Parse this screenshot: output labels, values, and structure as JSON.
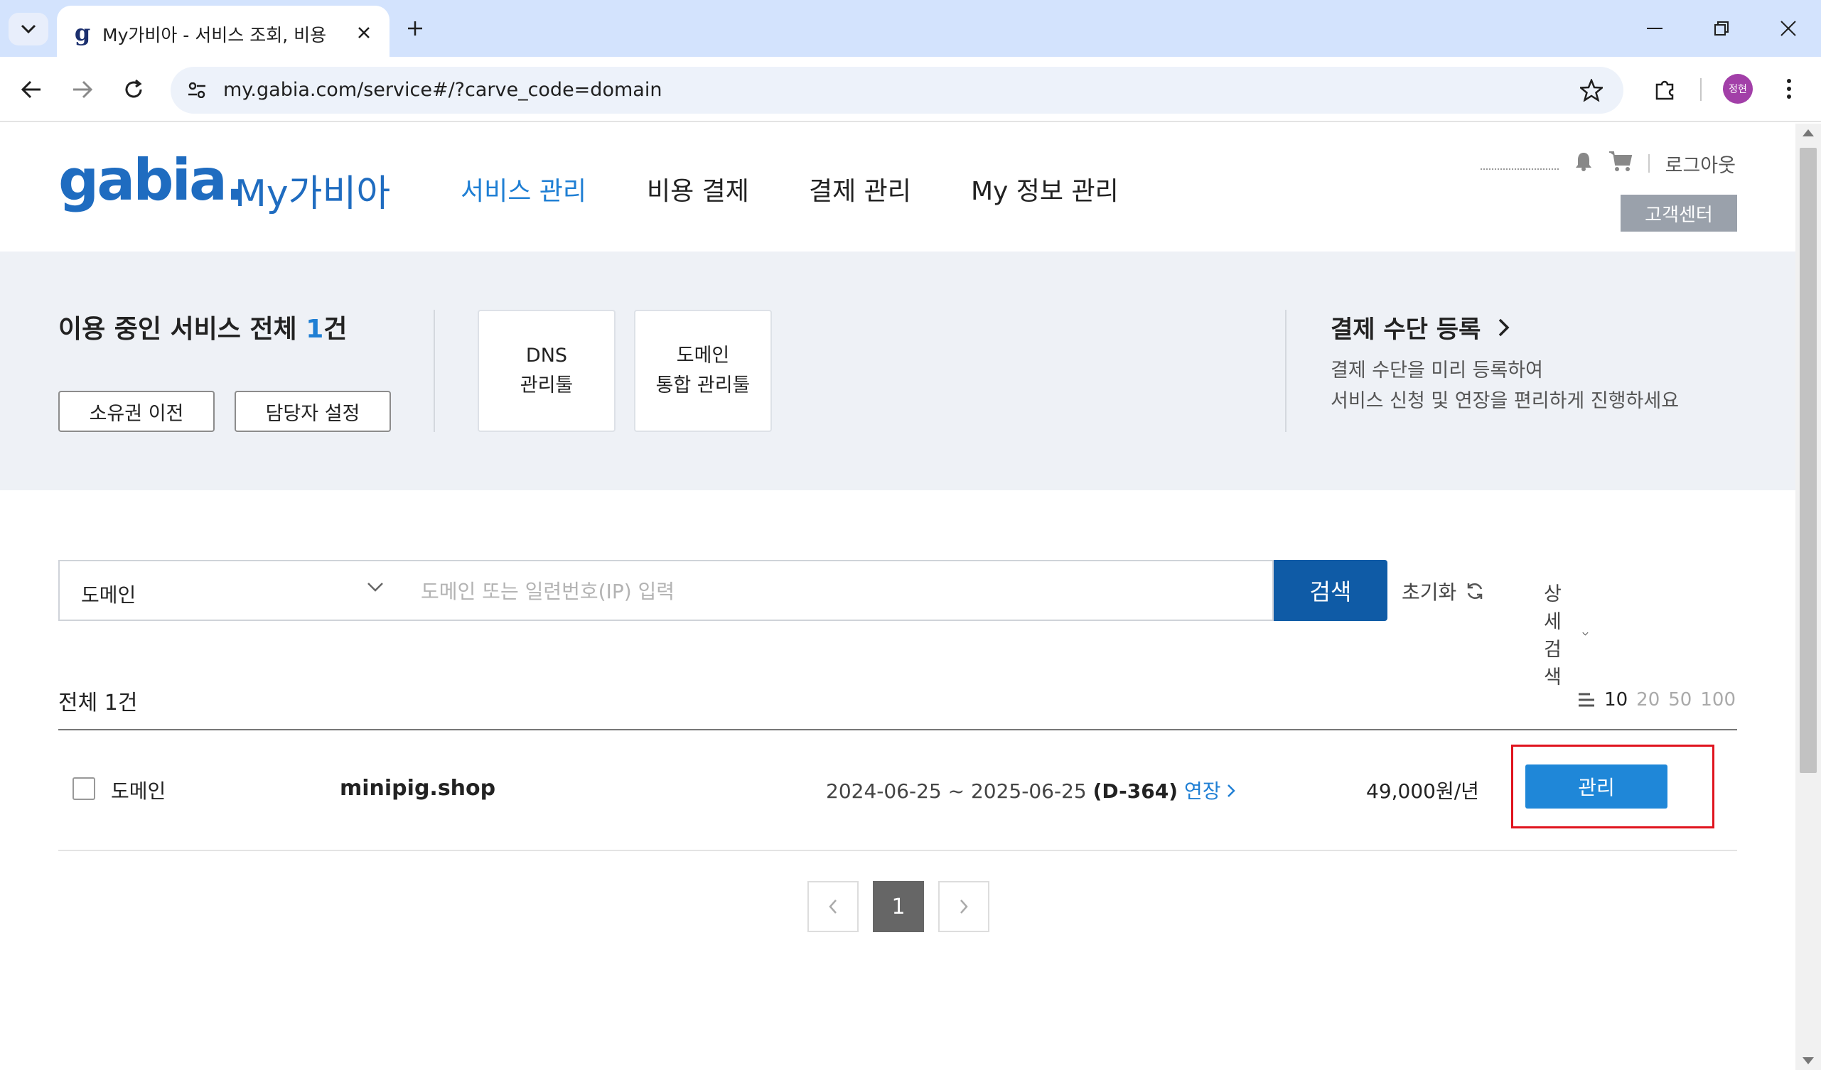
{
  "browser": {
    "tab_title": "My가비아 - 서비스 조회, 비용",
    "favicon_letter": "g",
    "url": "my.gabia.com/service#/?carve_code=domain",
    "profile_initials": "정현"
  },
  "header": {
    "logo_text": "gabia.",
    "logo_sub": "My가비아",
    "nav": [
      "서비스 관리",
      "비용 결제",
      "결제 관리",
      "My 정보 관리"
    ],
    "logout": "로그아웃",
    "customer_center": "고객센터"
  },
  "summary": {
    "title_prefix": "이용 중인 서비스 전체 ",
    "count": "1",
    "title_suffix": "건",
    "buttons": [
      "소유권 이전",
      "담당자 설정"
    ],
    "tools": [
      {
        "line1": "DNS",
        "line2": "관리툴"
      },
      {
        "line1": "도메인",
        "line2": "통합 관리툴"
      }
    ],
    "payment_title": "결제 수단 등록",
    "payment_desc_1": "결제 수단을 미리 등록하여",
    "payment_desc_2": "서비스 신청 및 연장을 편리하게 진행하세요"
  },
  "search": {
    "category": "도메인",
    "placeholder": "도메인 또는 일련번호(IP) 입력",
    "detail": "상세 검색",
    "button": "검색",
    "reset": "초기화"
  },
  "list": {
    "total": "전체 1건",
    "page_sizes": [
      "10",
      "20",
      "50",
      "100"
    ],
    "rows": [
      {
        "type": "도메인",
        "domain": "minipig.shop",
        "period": "2024-06-25 ~ 2025-06-25",
        "dday": "(D-364)",
        "renew": "연장",
        "price": "49,000원/년",
        "action": "관리"
      }
    ]
  },
  "pagination": {
    "current": "1"
  },
  "colors": {
    "brand": "#1f6cc0",
    "accent": "#1f87d8",
    "search_button": "#0f5ba6",
    "highlight": "#e0141e"
  }
}
